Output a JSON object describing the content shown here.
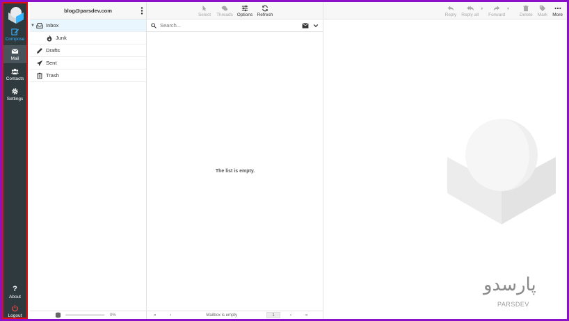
{
  "nav": {
    "compose": "Compose",
    "mail": "Mail",
    "contacts": "Contacts",
    "settings": "Settings",
    "about": "About",
    "logout": "Logout"
  },
  "folders": {
    "account": "blog@parsdev.com",
    "items": [
      "Inbox",
      "Junk",
      "Drafts",
      "Sent",
      "Trash"
    ],
    "quota": "0%"
  },
  "list_toolbar": {
    "select": "Select",
    "threads": "Threads",
    "options": "Options",
    "refresh": "Refresh"
  },
  "search": {
    "placeholder": "Search..."
  },
  "list": {
    "empty_message": "The list is empty.",
    "status": "Mailbox is empty",
    "page": "1"
  },
  "message_toolbar": {
    "reply": "Reply",
    "reply_all": "Reply all",
    "forward": "Forward",
    "delete": "Delete",
    "mark": "Mark",
    "more": "More"
  },
  "watermark": {
    "text": "PARSDEV",
    "script": "پارسدو"
  },
  "colors": {
    "nav_bg": "#2f3a3f",
    "accent": "#37b4ff",
    "outer_border": "#8a10c9",
    "nav_border": "#e01010"
  }
}
